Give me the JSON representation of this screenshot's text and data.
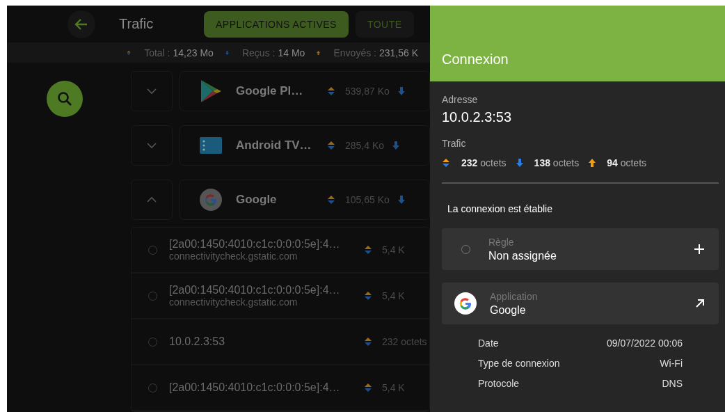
{
  "header": {
    "title": "Trafic",
    "tabs": [
      {
        "label": "APPLICATIONS ACTIVES",
        "selected": true
      },
      {
        "label": "TOUTE",
        "selected": false
      }
    ]
  },
  "summary": [
    {
      "kind": "total",
      "label": "Total :",
      "value": "14,23 Mo"
    },
    {
      "kind": "received",
      "label": "Reçus :",
      "value": "14 Mo"
    },
    {
      "kind": "sent",
      "label": "Envoyés :",
      "value": "231,56 K"
    }
  ],
  "apps": [
    {
      "kind": "play",
      "name": "Google Pl…",
      "total": "539,87 Ko",
      "expanded": false
    },
    {
      "kind": "tv",
      "name": "Android TV…",
      "total": "285,4 Ko",
      "expanded": false
    },
    {
      "kind": "google",
      "name": "Google",
      "total": "105,65 Ko",
      "expanded": true
    }
  ],
  "connections": [
    {
      "address": "[2a00:1450:4010:c1c:0:0:0:5e]:4…",
      "host": "connectivitycheck.gstatic.com",
      "total": "5,4 K"
    },
    {
      "address": "[2a00:1450:4010:c1c:0:0:0:5e]:4…",
      "host": "connectivitycheck.gstatic.com",
      "total": "5,4 K"
    },
    {
      "address": "10.0.2.3:53",
      "total": "232 octets"
    },
    {
      "address": "[2a00:1450:4010:c1c:0:0:0:5e]:4…",
      "total": "5,4 K"
    }
  ],
  "panel": {
    "title": "Connexion",
    "address_label": "Adresse",
    "address": "10.0.2.3:53",
    "traffic_label": "Trafic",
    "traffic": [
      {
        "kind": "total",
        "text": "**232** octets"
      },
      {
        "kind": "received",
        "text": "**138** octets"
      },
      {
        "kind": "sent",
        "text": "**94** octets"
      }
    ],
    "status": "La connexion est établie",
    "rule": {
      "label": "Règle",
      "value": "Non assignée"
    },
    "application": {
      "label": "Application",
      "value": "Google"
    },
    "details": [
      {
        "label": "Date",
        "value": "09/07/2022 00:06"
      },
      {
        "label": "Type de connexion",
        "value": "Wi-Fi"
      },
      {
        "label": "Protocole",
        "value": "DNS"
      }
    ]
  }
}
